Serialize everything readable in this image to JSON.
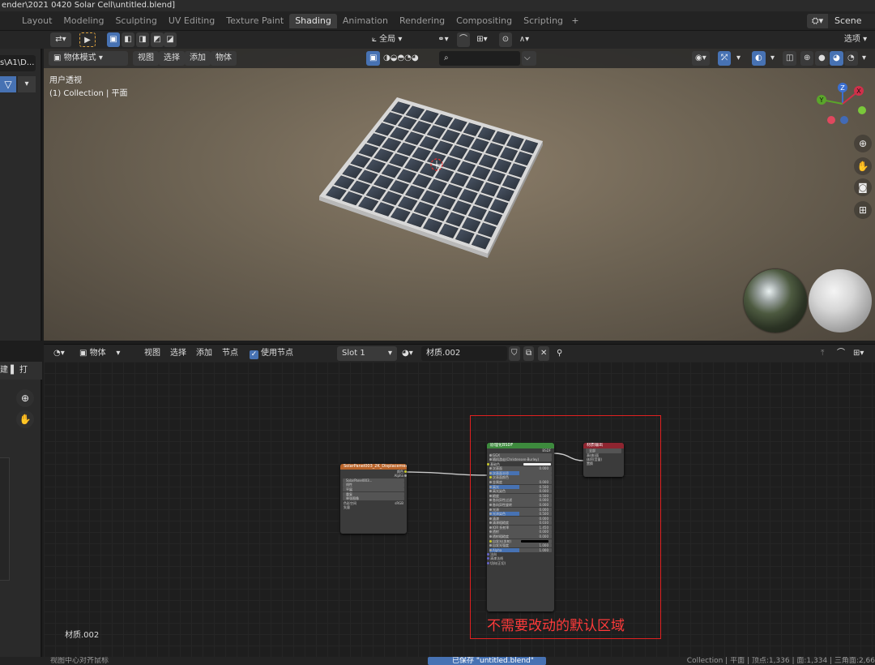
{
  "window": {
    "title": "ender\\2021 0420 Solar Cell\\untitled.blend]"
  },
  "workspaces": [
    "Layout",
    "Modeling",
    "Sculpting",
    "UV Editing",
    "Texture Paint",
    "Shading",
    "Animation",
    "Rendering",
    "Compositing",
    "Scripting"
  ],
  "active_workspace": "Shading",
  "scene": {
    "name": "Scene"
  },
  "toolbar": {
    "transform_orientation": "全局",
    "options": "选项"
  },
  "outliner_top": {
    "path": "s\\A1\\D..."
  },
  "viewport": {
    "mode": "物体模式",
    "menus": [
      "视图",
      "选择",
      "添加",
      "物体"
    ],
    "view_name": "用户透视",
    "collection_info": "(1) Collection | 平面",
    "gizmo": {
      "x": "X",
      "y": "Y",
      "z": "Z"
    }
  },
  "node_editor": {
    "object_type": "物体",
    "menus": [
      "视图",
      "选择",
      "添加",
      "节点"
    ],
    "use_nodes_label": "使用节点",
    "slot": "Slot 1",
    "material_name": "材质.002",
    "canvas_material_label": "材质.002",
    "annotation": "不需要改动的默认区域",
    "nodes": {
      "image": {
        "title": "SolarPanel003_2K_Displacement.png",
        "outputs": [
          "颜色",
          "Alpha"
        ],
        "rows": [
          "SolarPanel003...",
          "线性",
          "平展",
          "重复",
          "单张图像",
          "色彩空间",
          "sRGB",
          "矢量"
        ]
      },
      "bsdf": {
        "title": "原理化BSDF",
        "output": "BSDF",
        "rows": [
          "GGX",
          "随机游走(Christensen-Burley)",
          "基础色",
          "次表面",
          "次表面半径",
          "次表面颜色",
          "金属度",
          "高光",
          "高光染色",
          "糙度",
          "各向异性过滤",
          "各向异性旋转",
          "光泽",
          "光泽染色",
          "清漆",
          "清漆粗糙度",
          "IOR 折射率",
          "透射",
          "透射粗糙度",
          "自发光(发射)",
          "自发光强度",
          "Alpha",
          "法向",
          "清漆法线",
          "切向(正切)"
        ],
        "values": [
          "0.000",
          "",
          "",
          "0.000",
          "0.500",
          "0.000",
          "0.500",
          "0.000",
          "0.000",
          "0.000",
          "0.500",
          "0.000",
          "0.030",
          "1.450",
          "0.000",
          "0.000",
          "",
          "1.000",
          "1.000"
        ]
      },
      "output": {
        "title": "材质输出",
        "target": "全部",
        "inputs": [
          "表(曲)面",
          "体积(音量)",
          "置换"
        ]
      }
    }
  },
  "statusbar": {
    "left": "视图中心对齐鼠标",
    "saved": "已保存 \"untitled.blend\"",
    "right": "Collection | 平面 | 顶点:1,336 | 面:1,334 | 三角面:2,66"
  },
  "colors": {
    "accent": "#4772b3",
    "annotation": "#e02020",
    "bsdf_header": "#3d8a3d",
    "image_header": "#b8642a",
    "output_header": "#8e2530"
  }
}
